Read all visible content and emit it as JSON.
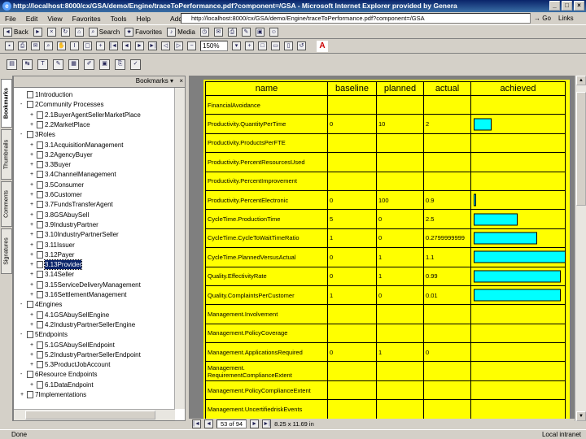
{
  "window": {
    "title": "http://localhost:8000/cx/GSA/demo/Engine/traceToPerformance.pdf?component=/GSA - Microsoft Internet Explorer provided by Genera",
    "controls": [
      "_",
      "□",
      "×"
    ]
  },
  "menu": {
    "items": [
      "File",
      "Edit",
      "View",
      "Favorites",
      "Tools",
      "Help"
    ],
    "address_label": "Address",
    "address_value": "http://localhost:8000/cx/GSA/demo/Engine/traceToPerformance.pdf?component=/GSA",
    "go_label": "Go",
    "links_label": "Links"
  },
  "toolbar1": {
    "back_label": "Back",
    "search_label": "Search",
    "favorites_label": "Favorites",
    "media_label": "Media"
  },
  "toolbar2": {
    "zoom": "150%"
  },
  "bookmarks": {
    "header": "Bookmarks",
    "close": "×",
    "items": [
      {
        "label": "1Introduction",
        "level": 0,
        "exp": ""
      },
      {
        "label": "2Community Processes",
        "level": 0,
        "exp": "-"
      },
      {
        "label": "2.1BuyerAgentSellerMarketPlace",
        "level": 1,
        "exp": "+"
      },
      {
        "label": "2.2MarketPlace",
        "level": 1,
        "exp": "+"
      },
      {
        "label": "3Roles",
        "level": 0,
        "exp": "-"
      },
      {
        "label": "3.1AcquisitionManagement",
        "level": 1,
        "exp": "+"
      },
      {
        "label": "3.2AgencyBuyer",
        "level": 1,
        "exp": "+"
      },
      {
        "label": "3.3Buyer",
        "level": 1,
        "exp": "+"
      },
      {
        "label": "3.4ChannelManagement",
        "level": 1,
        "exp": "+"
      },
      {
        "label": "3.5Consumer",
        "level": 1,
        "exp": "+"
      },
      {
        "label": "3.6Customer",
        "level": 1,
        "exp": "+"
      },
      {
        "label": "3.7FundsTransferAgent",
        "level": 1,
        "exp": "+"
      },
      {
        "label": "3.8GSAbuySell",
        "level": 1,
        "exp": "+"
      },
      {
        "label": "3.9IndustryPartner",
        "level": 1,
        "exp": "+"
      },
      {
        "label": "3.10IndustryPartnerSeller",
        "level": 1,
        "exp": "+"
      },
      {
        "label": "3.11Issuer",
        "level": 1,
        "exp": "+"
      },
      {
        "label": "3.12Payer",
        "level": 1,
        "exp": "+"
      },
      {
        "label": "3.13Provider",
        "level": 1,
        "exp": "+",
        "selected": true
      },
      {
        "label": "3.14Seller",
        "level": 1,
        "exp": "+"
      },
      {
        "label": "3.15ServiceDeliveryManagement",
        "level": 1,
        "exp": "+"
      },
      {
        "label": "3.16SettlementManagement",
        "level": 1,
        "exp": "+"
      },
      {
        "label": "4Engines",
        "level": 0,
        "exp": "-"
      },
      {
        "label": "4.1GSAbuySellEngine",
        "level": 1,
        "exp": "+"
      },
      {
        "label": "4.2IndustryPartnerSellerEngine",
        "level": 1,
        "exp": "+"
      },
      {
        "label": "5Endpoints",
        "level": 0,
        "exp": "-"
      },
      {
        "label": "5.1GSAbuySellEndpoint",
        "level": 1,
        "exp": "+"
      },
      {
        "label": "5.2IndustryPartnerSellerEndpoint",
        "level": 1,
        "exp": "+"
      },
      {
        "label": "5.3ProductJobAccount",
        "level": 1,
        "exp": "+"
      },
      {
        "label": "6Resource Endpoints",
        "level": 0,
        "exp": "-"
      },
      {
        "label": "6.1DataEndpoint",
        "level": 1,
        "exp": "+"
      },
      {
        "label": "7Implementations",
        "level": 0,
        "exp": "+"
      }
    ]
  },
  "nav_tabs": [
    "Bookmarks",
    "Thumbnails",
    "Comments",
    "Signatures"
  ],
  "table": {
    "headers": [
      "name",
      "baseline",
      "planned",
      "actual",
      "achieved"
    ],
    "rows": [
      {
        "name": "FinancialAvoidance",
        "baseline": "",
        "planned": "",
        "actual": "",
        "achieved": 0
      },
      {
        "name": "Productivity.QuantityPerTime",
        "baseline": "0",
        "planned": "10",
        "actual": "2",
        "achieved": 0.2
      },
      {
        "name": "Productivity.ProductsPerFTE",
        "baseline": "",
        "planned": "",
        "actual": "",
        "achieved": 0
      },
      {
        "name": "Productivity.PercentResourcesUsed",
        "baseline": "",
        "planned": "",
        "actual": "",
        "achieved": 0
      },
      {
        "name": "Productivity.PercentImprovement",
        "baseline": "",
        "planned": "",
        "actual": "",
        "achieved": 0
      },
      {
        "name": "Productivity.PercentElectronic",
        "baseline": "0",
        "planned": "100",
        "actual": "0.9",
        "achieved": 0.009
      },
      {
        "name": "CycleTime.ProductionTime",
        "baseline": "5",
        "planned": "0",
        "actual": "2.5",
        "achieved": 0.5
      },
      {
        "name": "CycleTime.CycleToWaitTimeRatio",
        "baseline": "1",
        "planned": "0",
        "actual": "0.2799999999",
        "achieved": 0.72
      },
      {
        "name": "CycleTime.PlannedVersusActual",
        "baseline": "0",
        "planned": "1",
        "actual": "1.1",
        "achieved": 1.1
      },
      {
        "name": "Quality.EffectivityRate",
        "baseline": "0",
        "planned": "1",
        "actual": "0.99",
        "achieved": 0.99
      },
      {
        "name": "Quality.ComplaintsPerCustomer",
        "baseline": "1",
        "planned": "0",
        "actual": "0.01",
        "achieved": 0.99
      },
      {
        "name": "Management.Involvement",
        "baseline": "",
        "planned": "",
        "actual": "",
        "achieved": 0
      },
      {
        "name": "Management.PolicyCoverage",
        "baseline": "",
        "planned": "",
        "actual": "",
        "achieved": 0
      },
      {
        "name": "Management.ApplicationsRequired",
        "baseline": "0",
        "planned": "1",
        "actual": "0",
        "achieved": 0
      },
      {
        "name": "Management.\nRequirementComplianceExtent",
        "baseline": "",
        "planned": "",
        "actual": "",
        "achieved": 0
      },
      {
        "name": "Management.PolicyComplianceExtent",
        "baseline": "",
        "planned": "",
        "actual": "",
        "achieved": 0
      },
      {
        "name": "Management.UncertifiedriskEvents",
        "baseline": "",
        "planned": "",
        "actual": "",
        "achieved": 0
      }
    ]
  },
  "pagebar": {
    "page": "53 of 94",
    "size": "8.25 x 11.69 in"
  },
  "status": {
    "text": "Done",
    "zone": "Local intranet"
  },
  "colors": {
    "page_bg": "#ffff00",
    "bar": "#00ffff",
    "selection": "#0a246a"
  }
}
